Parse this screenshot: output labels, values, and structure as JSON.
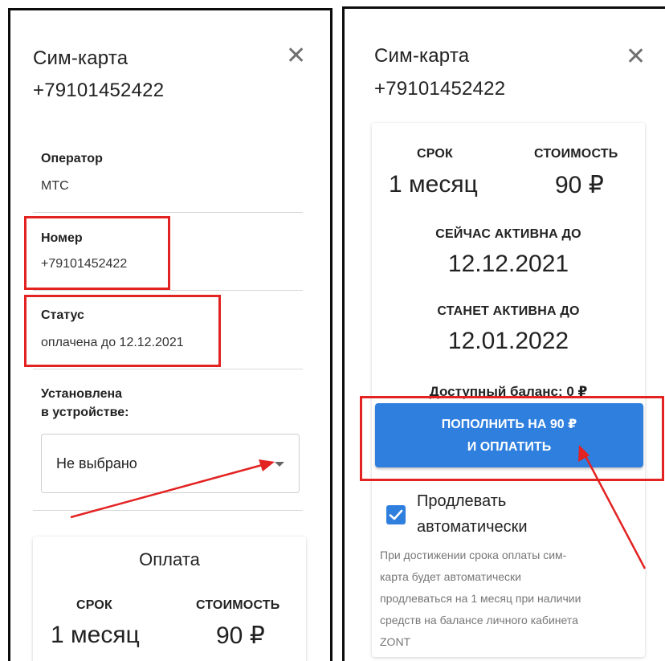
{
  "left": {
    "title": "Сим-карта",
    "phone": "+79101452422",
    "operator_label": "Оператор",
    "operator_value": "МТС",
    "number_label": "Номер",
    "number_value": "+79101452422",
    "status_label": "Статус",
    "status_value": "оплачена до 12.12.2021",
    "installed_label_1": "Установлена",
    "installed_label_2": "в устройстве:",
    "device_select_value": "Не выбрано",
    "payment_title": "Оплата",
    "term_label": "СРОК",
    "cost_label": "СТОИМОСТЬ",
    "term_value": "1 месяц",
    "cost_value": "90 ₽"
  },
  "right": {
    "title": "Сим-карта",
    "phone": "+79101452422",
    "term_label": "СРОК",
    "cost_label": "СТОИМОСТЬ",
    "term_value": "1 месяц",
    "cost_value": "90 ₽",
    "active_now_label": "СЕЙЧАС АКТИВНА ДО",
    "active_now_value": "12.12.2021",
    "will_active_label": "СТАНЕТ АКТИВНА ДО",
    "will_active_value": "12.01.2022",
    "balance_text": "Доступный баланс: 0 ₽",
    "pay_button_line1": "ПОПОЛНИТЬ НА 90 ₽",
    "pay_button_line2": "И ОПЛАТИТЬ",
    "auto_renew_line1": "Продлевать",
    "auto_renew_line2": "автоматически",
    "hint_line1": "При достижении срока оплаты сим-",
    "hint_line2": "карта будет автоматически",
    "hint_line3": "продлеваться на 1 месяц при наличии",
    "hint_line4": "средств на балансе личного кабинета",
    "hint_line5": "ZONT"
  },
  "icons": {
    "close": "close-icon",
    "dropdown": "chevron-down-icon",
    "checkbox": "check-icon"
  },
  "colors": {
    "accent": "#2f7fde",
    "highlight": "#e32222"
  }
}
